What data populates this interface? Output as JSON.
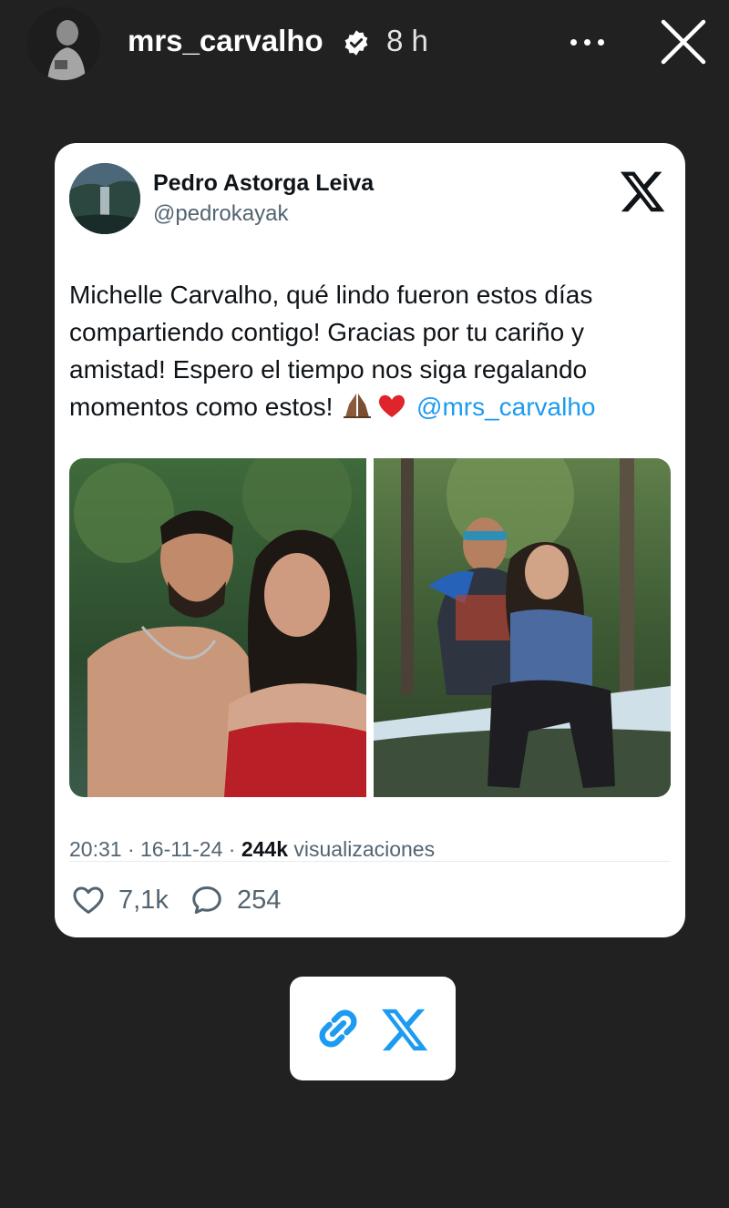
{
  "story": {
    "username": "mrs_carvalho",
    "time": "8 h",
    "icons": [
      "verified-icon",
      "more-icon",
      "close-icon"
    ]
  },
  "tweet": {
    "author_name": "Pedro Astorga Leiva",
    "author_handle": "@pedrokayak",
    "text_parts": [
      "Michelle Carvalho, qué lindo fueron estos días compartiendo contigo! Gracias por tu cariño y amistad! Espero el tiempo nos siga regalando momentos como estos! ",
      "@mrs_carvalho"
    ],
    "emojis": [
      "🙏🏾",
      "❤️"
    ],
    "time": "20:31",
    "date": "16-11-24",
    "separator": " · ",
    "views_count": "244k",
    "views_label": "visualizaciones",
    "likes": "7,1k",
    "replies": "254"
  },
  "sticker": {
    "icons": [
      "link-icon",
      "x-logo-icon"
    ]
  },
  "colors": {
    "background": "#212121",
    "card": "#ffffff",
    "mention": "#1d9bf0",
    "muted": "#536471",
    "link_blue": "#1d9bf0"
  }
}
